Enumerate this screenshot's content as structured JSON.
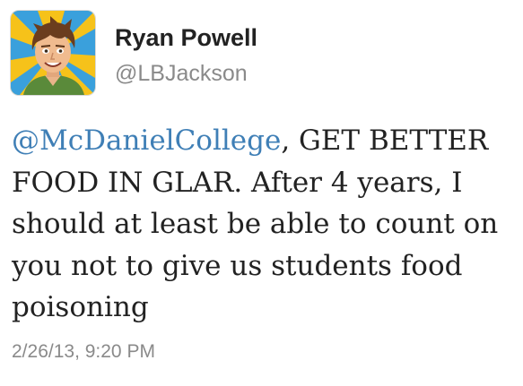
{
  "author": {
    "display_name": "Ryan Powell",
    "handle": "@LBJackson",
    "avatar_icon": "cartoon-avatar-icon"
  },
  "tweet": {
    "mention": "@McDanielCollege",
    "lines": [
      ", GET BETTER",
      "FOOD IN GLAR. After 4 years, I",
      "should at least be able to count on",
      "you not to give us students food",
      "poisoning"
    ],
    "timestamp": "2/26/13, 9:20 PM"
  },
  "colors": {
    "link": "#3f7fb6",
    "text": "#222222",
    "secondary": "#8a8a8a"
  }
}
